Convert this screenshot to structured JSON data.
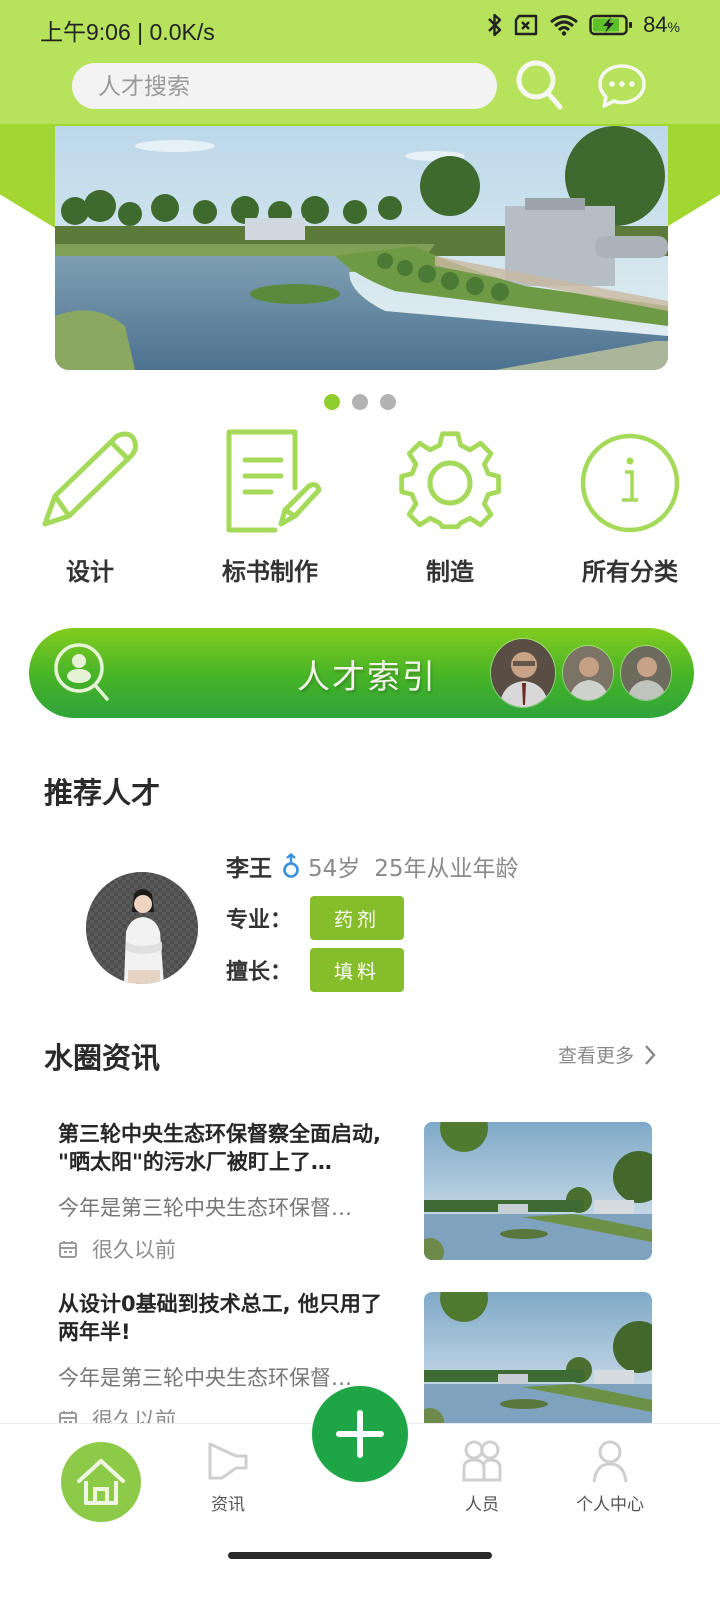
{
  "status_bar": {
    "time": "上午9:06 | 0.0K/s",
    "icons": [
      "bluetooth-icon",
      "sim-no-signal-icon",
      "wifi-icon",
      "battery-charging-icon"
    ],
    "battery": "84",
    "battery_unit": "%"
  },
  "header": {
    "search_placeholder": "人才搜索",
    "search_icon": "search-icon",
    "message_icon": "chat-bubble-icon"
  },
  "banner": {
    "slide_count": 3,
    "active_slide": 1,
    "image_desc": "wastewater treatment plant by a lake"
  },
  "categories": [
    {
      "label": "设计",
      "icon": "pencil-icon"
    },
    {
      "label": "标书制作",
      "icon": "document-edit-icon"
    },
    {
      "label": "制造",
      "icon": "gear-icon"
    },
    {
      "label": "所有分类",
      "icon": "info-icon"
    }
  ],
  "talent_index": {
    "title": "人才索引",
    "icon": "person-search-icon",
    "avatar_count": 3
  },
  "recommended": {
    "section_title": "推荐人才",
    "talent": {
      "name": "李王",
      "gender": "male",
      "age": "54岁",
      "experience": "25年从业年龄",
      "major_label": "专业：",
      "major": "药剂",
      "skill_label": "擅长：",
      "skill": "填料"
    }
  },
  "news": {
    "section_title": "水圈资讯",
    "more_label": "查看更多",
    "items": [
      {
        "title": "第三轮中央生态环保督察全面启动, \"晒太阳\"的污水厂被盯上了…",
        "summary": "今年是第三轮中央生态环保督…",
        "time": "很久以前"
      },
      {
        "title": "从设计0基础到技术总工, 他只用了两年半!",
        "summary": "今年是第三轮中央生态环保督…",
        "time": "很久以前"
      }
    ]
  },
  "bottom_nav": {
    "items": [
      {
        "label": "",
        "icon": "home-icon",
        "active": true
      },
      {
        "label": "资讯",
        "icon": "megaphone-icon"
      },
      {
        "label": "",
        "icon": "plus-icon"
      },
      {
        "label": "人员",
        "icon": "people-icon"
      },
      {
        "label": "个人中心",
        "icon": "user-icon"
      }
    ]
  },
  "colors": {
    "header_green": "#b6e35b",
    "accent_green": "#a2d731",
    "icon_green": "#a5d95a",
    "tag_green": "#86bd2a",
    "fab_green": "#1ea646",
    "home_green": "#8dca48"
  }
}
